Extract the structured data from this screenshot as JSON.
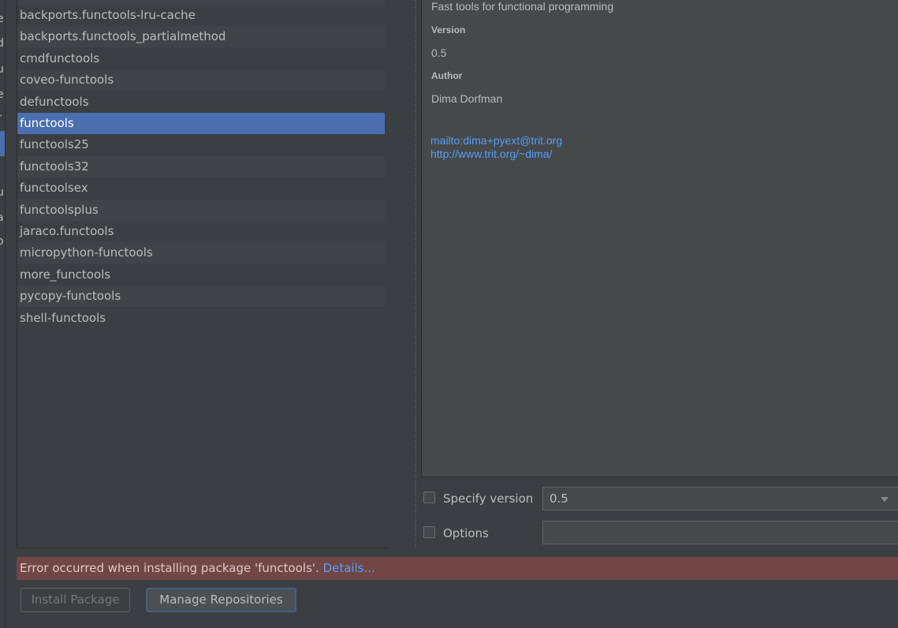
{
  "left_strip": {
    "fragments": [
      "e",
      "d",
      "u",
      "e",
      "r",
      "u",
      "a",
      "o"
    ]
  },
  "packages": [
    "backports.functools-lru-cache",
    "backports.functools_partialmethod",
    "cmdfunctools",
    "coveo-functools",
    "defunctools",
    "functools",
    "functools25",
    "functools32",
    "functoolsex",
    "functoolsplus",
    "jaraco.functools",
    "micropython-functools",
    "more_functools",
    "pycopy-functools",
    "shell-functools"
  ],
  "selected_package": "functools",
  "description": {
    "summary": "Fast tools for functional programming",
    "version_label": "Version",
    "version_value": "0.5",
    "author_label": "Author",
    "author_value": "Dima Dorfman",
    "links": [
      "mailto:dima+pyext@trit.org",
      "http://www.trit.org/~dima/"
    ]
  },
  "options": {
    "specify_version_label": "Specify version",
    "specify_version_checked": false,
    "version_selected": "0.5",
    "options_label": "Options",
    "options_checked": false,
    "options_value": ""
  },
  "error": {
    "message": "Error occurred when installing package 'functools'.",
    "details_link": "Details..."
  },
  "buttons": {
    "install": "Install Package",
    "manage": "Manage Repositories"
  },
  "colors": {
    "background": "#3c3f41",
    "selection": "#4b6eaf",
    "link": "#589df6",
    "error_bar": "#704745"
  }
}
